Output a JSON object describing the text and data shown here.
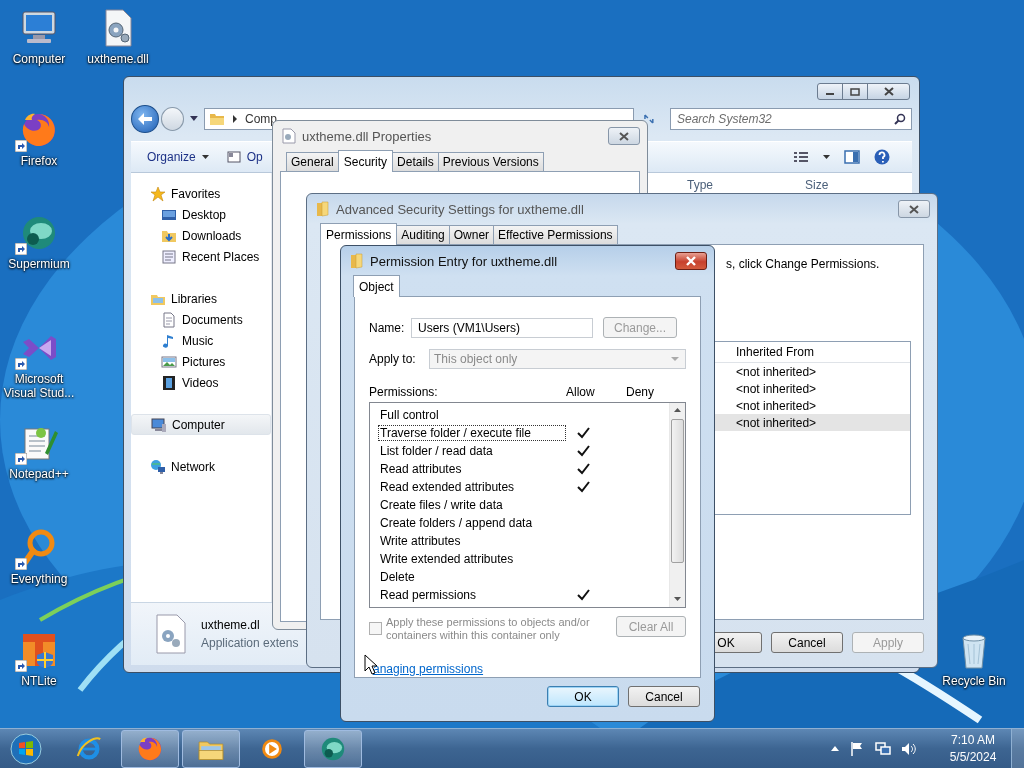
{
  "desktop_icons": [
    {
      "label": "Computer",
      "kind": "computer",
      "shortcut": false
    },
    {
      "label": "uxtheme.dll",
      "kind": "dll",
      "shortcut": false
    },
    {
      "label": "Firefox",
      "kind": "firefox",
      "shortcut": true
    },
    {
      "label": "Supermium",
      "kind": "supermium",
      "shortcut": true
    },
    {
      "label": "Microsoft Visual Stud...",
      "kind": "visualstudio",
      "shortcut": true
    },
    {
      "label": "Notepad++",
      "kind": "notepad",
      "shortcut": true
    },
    {
      "label": "Everything",
      "kind": "everything",
      "shortcut": true
    },
    {
      "label": "NTLite",
      "kind": "ntlite",
      "shortcut": true
    },
    {
      "label": "Recycle Bin",
      "kind": "recycle",
      "shortcut": false
    }
  ],
  "explorer": {
    "address": "Comp",
    "search_placeholder": "Search System32",
    "toolbar": [
      {
        "label": "Organize",
        "kind": "menu"
      },
      {
        "label": "Op",
        "kind": "open"
      }
    ],
    "columns": [
      "Type",
      "Size"
    ],
    "nav": [
      {
        "label": "Favorites",
        "kind": "favorites",
        "selected": false,
        "children": [
          {
            "label": "Desktop",
            "kind": "desktop",
            "selected": false
          },
          {
            "label": "Downloads",
            "kind": "downloads",
            "selected": false
          },
          {
            "label": "Recent Places",
            "kind": "recent",
            "selected": false
          }
        ]
      },
      {
        "label": "Libraries",
        "kind": "libraries",
        "selected": false,
        "children": [
          {
            "label": "Documents",
            "kind": "documents",
            "selected": false
          },
          {
            "label": "Music",
            "kind": "music",
            "selected": false
          },
          {
            "label": "Pictures",
            "kind": "pictures",
            "selected": false
          },
          {
            "label": "Videos",
            "kind": "videos",
            "selected": false
          }
        ]
      },
      {
        "label": "Computer",
        "kind": "computer",
        "selected": true
      },
      {
        "label": "Network",
        "kind": "network",
        "selected": false
      }
    ],
    "details": {
      "name": "uxtheme.dl",
      "type": "Application extens"
    }
  },
  "properties": {
    "title": "uxtheme.dll Properties",
    "tabs": [
      {
        "label": "General",
        "selected": false
      },
      {
        "label": "Security",
        "selected": true
      },
      {
        "label": "Details",
        "selected": false
      },
      {
        "label": "Previous Versions",
        "selected": false
      }
    ]
  },
  "advanced": {
    "title": "Advanced Security Settings for uxtheme.dll",
    "tabs": [
      {
        "label": "Permissions",
        "selected": true
      },
      {
        "label": "Auditing",
        "selected": false
      },
      {
        "label": "Owner",
        "selected": false
      },
      {
        "label": "Effective Permissions",
        "selected": false
      }
    ],
    "hint": "s, click Change Permissions.",
    "column": "Inherited From",
    "rows": [
      {
        "inherited_from": "<not inherited>",
        "selected": false
      },
      {
        "inherited_from": "<not inherited>",
        "selected": false
      },
      {
        "inherited_from": "<not inherited>",
        "selected": false
      },
      {
        "inherited_from": "<not inherited>",
        "selected": true
      }
    ],
    "buttons": [
      {
        "label": "OK",
        "disabled": false
      },
      {
        "label": "Cancel",
        "disabled": false
      },
      {
        "label": "Apply",
        "disabled": true
      }
    ]
  },
  "permission_entry": {
    "title": "Permission Entry for uxtheme.dll",
    "tabs": [
      {
        "label": "Object",
        "selected": true
      }
    ],
    "name_label": "Name:",
    "name_value": "Users (VM1\\Users)",
    "change_button": {
      "label": "Change...",
      "disabled": true
    },
    "apply_to_label": "Apply to:",
    "apply_to": {
      "value": "This object only",
      "disabled": true
    },
    "permissions_label": "Permissions:",
    "allow_label": "Allow",
    "deny_label": "Deny",
    "permissions": [
      {
        "label": "Full control",
        "allow": false,
        "deny": false,
        "focused": false
      },
      {
        "label": "Traverse folder / execute file",
        "allow": true,
        "deny": false,
        "focused": true
      },
      {
        "label": "List folder / read data",
        "allow": true,
        "deny": false,
        "focused": false
      },
      {
        "label": "Read attributes",
        "allow": true,
        "deny": false,
        "focused": false
      },
      {
        "label": "Read extended attributes",
        "allow": true,
        "deny": false,
        "focused": false
      },
      {
        "label": "Create files / write data",
        "allow": false,
        "deny": false,
        "focused": false
      },
      {
        "label": "Create folders / append data",
        "allow": false,
        "deny": false,
        "focused": false
      },
      {
        "label": "Write attributes",
        "allow": false,
        "deny": false,
        "focused": false
      },
      {
        "label": "Write extended attributes",
        "allow": false,
        "deny": false,
        "focused": false
      },
      {
        "label": "Delete",
        "allow": false,
        "deny": false,
        "focused": false
      },
      {
        "label": "Read permissions",
        "allow": true,
        "deny": false,
        "focused": false
      }
    ],
    "apply_inside": {
      "label": "Apply these permissions to objects and/or containers within this container only",
      "checked": false,
      "disabled": true
    },
    "clear_all": {
      "label": "Clear All",
      "disabled": true
    },
    "link": "anaging permissions",
    "buttons": [
      {
        "label": "OK",
        "default": true
      },
      {
        "label": "Cancel",
        "default": false
      }
    ]
  },
  "taskbar": {
    "items": [
      {
        "kind": "ie",
        "active": false
      },
      {
        "kind": "firefox",
        "active": true
      },
      {
        "kind": "explorer",
        "active": true
      },
      {
        "kind": "media",
        "active": false
      },
      {
        "kind": "supermium",
        "active": true
      }
    ],
    "time": "7:10 AM",
    "date": "5/5/2024"
  }
}
